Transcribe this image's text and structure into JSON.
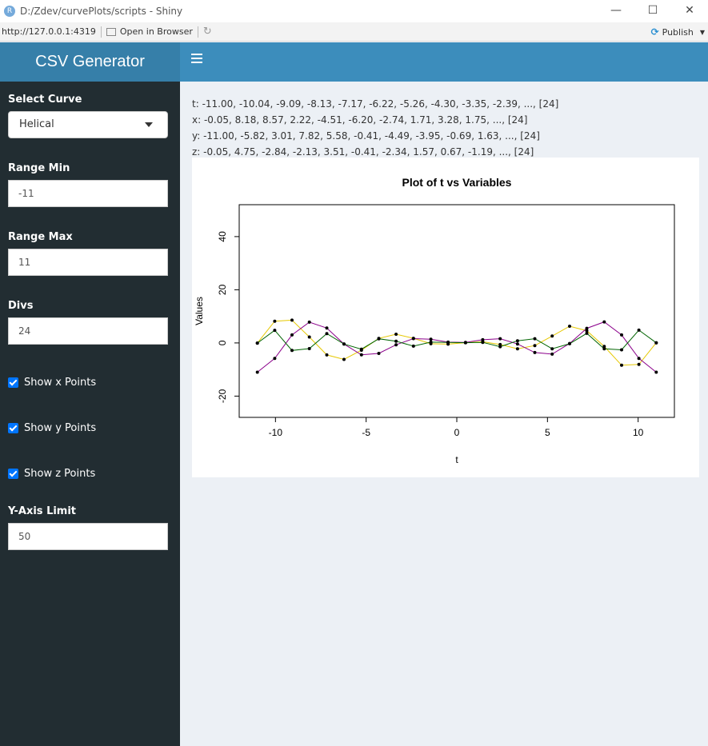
{
  "window": {
    "title": "D:/Zdev/curvePlots/scripts - Shiny",
    "app_icon_letter": "R",
    "minimize": "—",
    "maximize": "☐",
    "close": "✕"
  },
  "toolbar": {
    "url": "http://127.0.0.1:4319",
    "open_in_browser": "Open in Browser",
    "publish": "Publish"
  },
  "header": {
    "brand": "CSV Generator"
  },
  "sidebar": {
    "select_curve": {
      "label": "Select Curve",
      "value": "Helical"
    },
    "range_min": {
      "label": "Range Min",
      "value": "-11"
    },
    "range_max": {
      "label": "Range Max",
      "value": "11"
    },
    "divs": {
      "label": "Divs",
      "value": "24"
    },
    "show_x": {
      "label": "Show x Points",
      "checked": true
    },
    "show_y": {
      "label": "Show y Points",
      "checked": true
    },
    "show_z": {
      "label": "Show z Points",
      "checked": true
    },
    "y_axis_limit": {
      "label": "Y-Axis Limit",
      "value": "50"
    }
  },
  "summary": {
    "t": "t: -11.00, -10.04, -9.09, -8.13, -7.17, -6.22, -5.26, -4.30, -3.35, -2.39, ..., [24]",
    "x": "x: -0.05, 8.18, 8.57, 2.22, -4.51, -6.20, -2.74, 1.71, 3.28, 1.75, ..., [24]",
    "y": "y: -11.00, -5.82, 3.01, 7.82, 5.58, -0.41, -4.49, -3.95, -0.69, 1.63, ..., [24]",
    "z": "z: -0.05, 4.75, -2.84, -2.13, 3.51, -0.41, -2.34, 1.57, 0.67, -1.19, ..., [24]"
  },
  "chart_data": {
    "type": "line",
    "title": "Plot of t vs Variables",
    "xlabel": "t",
    "ylabel": "Values",
    "xlim": [
      -12,
      12
    ],
    "ylim": [
      -28,
      52
    ],
    "xticks": [
      -10,
      -5,
      0,
      5,
      10
    ],
    "yticks": [
      -20,
      0,
      20,
      40
    ],
    "grid": false,
    "legend": "none",
    "x": [
      -11.0,
      -10.04,
      -9.09,
      -8.13,
      -7.17,
      -6.22,
      -5.26,
      -4.3,
      -3.35,
      -2.39,
      -1.43,
      -0.48,
      0.48,
      1.43,
      2.39,
      3.35,
      4.3,
      5.26,
      6.22,
      7.17,
      8.13,
      9.09,
      10.04,
      11.0
    ],
    "series": [
      {
        "color": "#e6c800",
        "values": [
          -0.05,
          8.18,
          8.57,
          2.22,
          -4.51,
          -6.2,
          -2.74,
          1.71,
          3.28,
          1.75,
          -0.3,
          -0.45,
          0.1,
          0.45,
          -0.6,
          -2.2,
          -1.0,
          2.6,
          6.3,
          4.6,
          -1.3,
          -8.4,
          -8.1,
          0.05
        ]
      },
      {
        "color": "#8b008b",
        "values": [
          -11.0,
          -5.82,
          3.01,
          7.82,
          5.58,
          -0.41,
          -4.49,
          -3.95,
          -0.69,
          1.63,
          1.4,
          0.3,
          0.2,
          1.2,
          1.6,
          -0.4,
          -3.6,
          -4.2,
          -0.2,
          5.5,
          7.9,
          3.0,
          -5.8,
          -11.0
        ]
      },
      {
        "color": "#006400",
        "values": [
          -0.05,
          4.75,
          -2.84,
          -2.13,
          3.51,
          -0.41,
          -2.34,
          1.57,
          0.67,
          -1.19,
          0.3,
          0.2,
          0.1,
          0.2,
          -1.4,
          0.8,
          1.6,
          -2.2,
          -0.3,
          3.6,
          -2.2,
          -2.6,
          4.8,
          0.05
        ]
      }
    ]
  }
}
